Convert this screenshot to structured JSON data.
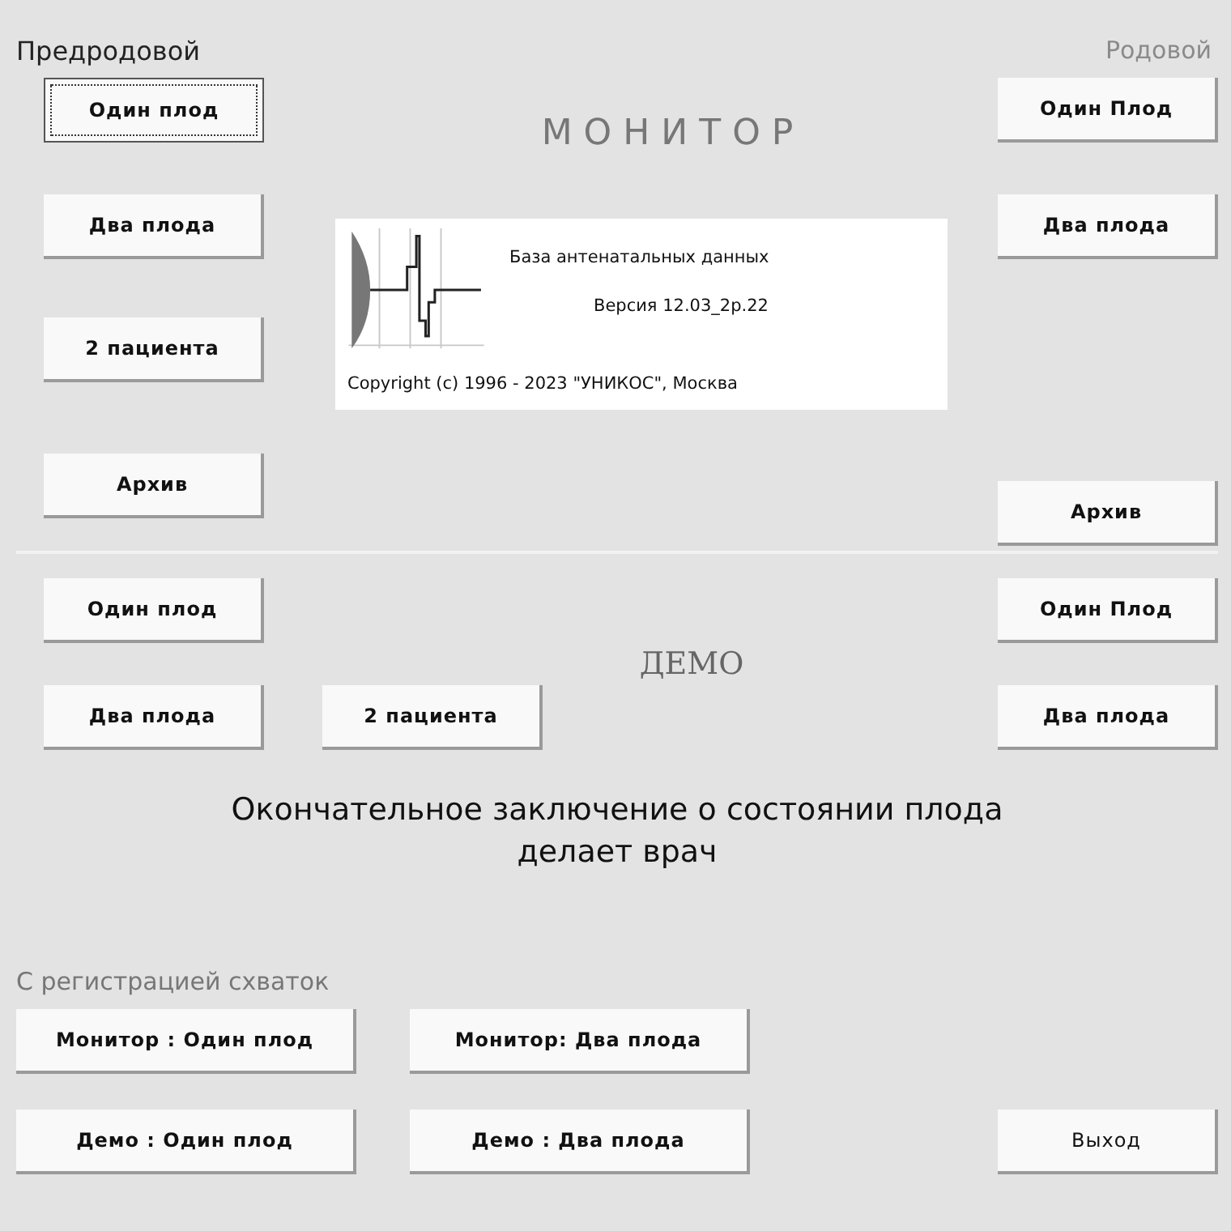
{
  "headers": {
    "left": "Предродовой",
    "right": "Родовой"
  },
  "monitor": {
    "title": "МОНИТОР",
    "left_buttons": [
      {
        "label": "Один плод",
        "focused": true
      },
      {
        "label": "Два плода",
        "focused": false
      },
      {
        "label": "2 пациента",
        "focused": false
      },
      {
        "label": "Архив",
        "focused": false
      }
    ],
    "right_buttons": [
      {
        "label": "Один Плод"
      },
      {
        "label": "Два плода"
      },
      {
        "label": "Архив"
      }
    ],
    "about": {
      "product": "База антенатальных данных",
      "version": "Версия 12.03_2р.22",
      "copyright": "Copyright (c) 1996 - 2023 \"УНИКОС\", Москва"
    }
  },
  "demo": {
    "title": "ДЕМО",
    "left_buttons": [
      {
        "label": "Один плод"
      },
      {
        "label": "Два плода"
      }
    ],
    "middle_button": {
      "label": "2 пациента"
    },
    "right_buttons": [
      {
        "label": "Один Плод"
      },
      {
        "label": "Два плода"
      }
    ]
  },
  "notice": "Окончательное заключение о состоянии плода делает врач",
  "contractions": {
    "title": "С регистрацией схваток",
    "monitor_buttons": [
      {
        "label": "Монитор : Один плод"
      },
      {
        "label": "Монитор: Два плода"
      }
    ],
    "demo_buttons": [
      {
        "label": "Демо : Один плод"
      },
      {
        "label": "Демо : Два плода"
      }
    ]
  },
  "exit_button": {
    "label": "Выход"
  }
}
